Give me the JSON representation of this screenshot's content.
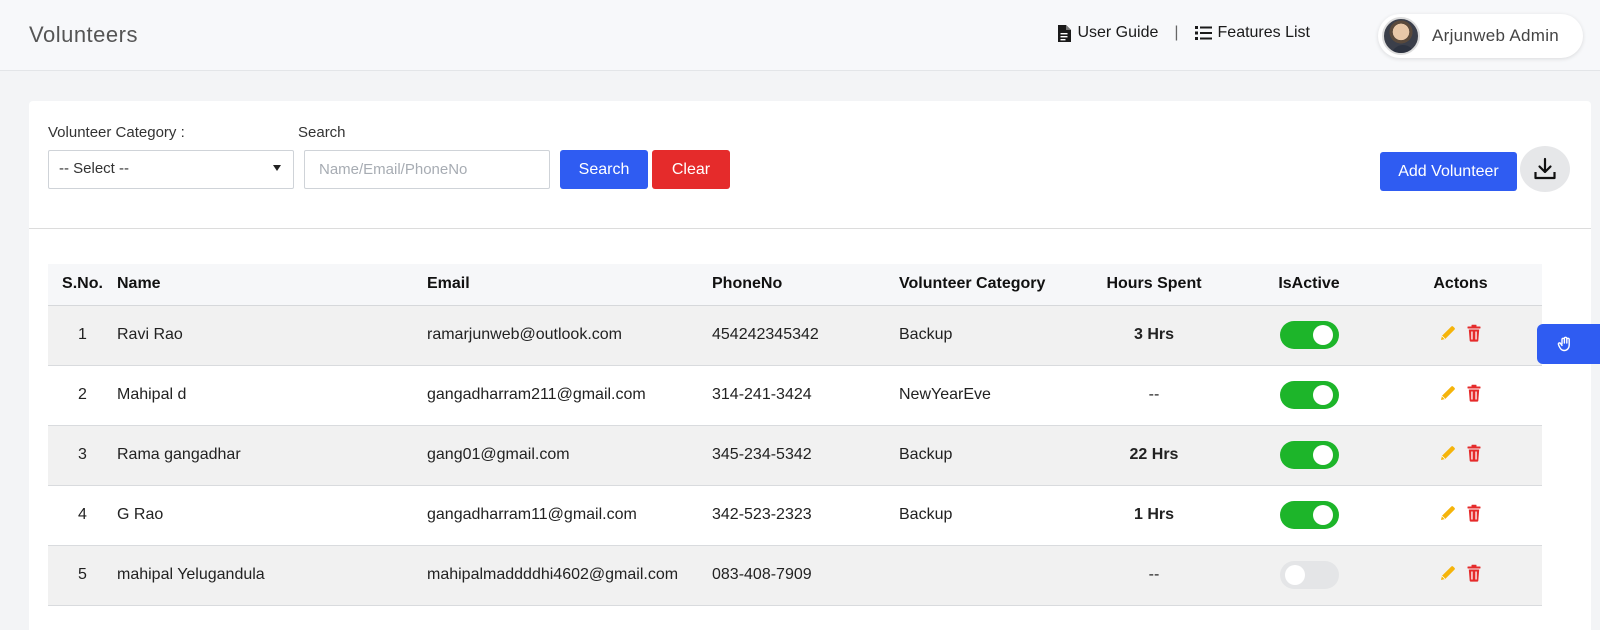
{
  "header": {
    "title": "Volunteers",
    "user_guide": "User Guide",
    "separator": "|",
    "features_list": "Features List",
    "user_name": "Arjunweb Admin"
  },
  "filters": {
    "category_label": "Volunteer Category :",
    "category_selected": "-- Select --",
    "search_label": "Search",
    "search_placeholder": "Name/Email/PhoneNo",
    "search_value": "",
    "search_button": "Search",
    "clear_button": "Clear",
    "add_button": "Add Volunteer"
  },
  "table": {
    "headers": {
      "sno": "S.No.",
      "name": "Name",
      "email": "Email",
      "phone": "PhoneNo",
      "category": "Volunteer Category",
      "hours": "Hours Spent",
      "active": "IsActive",
      "actions": "Actons"
    },
    "rows": [
      {
        "sno": "1",
        "name": "Ravi Rao",
        "email": "ramarjunweb@outlook.com",
        "phone": "454242345342",
        "category": "Backup",
        "hours": "3 Hrs",
        "active": true
      },
      {
        "sno": "2",
        "name": "Mahipal d",
        "email": "gangadharram211@gmail.com",
        "phone": "314-241-3424",
        "category": "NewYearEve",
        "hours": "--",
        "active": true
      },
      {
        "sno": "3",
        "name": "Rama gangadhar",
        "email": "gang01@gmail.com",
        "phone": "345-234-5342",
        "category": "Backup",
        "hours": "22 Hrs",
        "active": true
      },
      {
        "sno": "4",
        "name": "G Rao",
        "email": "gangadharram11@gmail.com",
        "phone": "342-523-2323",
        "category": "Backup",
        "hours": "1 Hrs",
        "active": true
      },
      {
        "sno": "5",
        "name": "mahipal Yelugandula",
        "email": "mahipalmaddddhi4602@gmail.com",
        "phone": "083-408-7909",
        "category": "",
        "hours": "--",
        "active": false
      }
    ]
  },
  "colors": {
    "primary": "#2f5cf2",
    "danger": "#e52b2b",
    "toggle_on": "#1db52a",
    "edit_icon": "#f5b40a",
    "delete_icon": "#e52b2b"
  },
  "icons": {
    "user_guide": "document-icon",
    "features_list": "list-icon",
    "download": "download-icon",
    "edit": "pencil-icon",
    "delete": "trash-icon",
    "side_tab": "hand-icon"
  }
}
